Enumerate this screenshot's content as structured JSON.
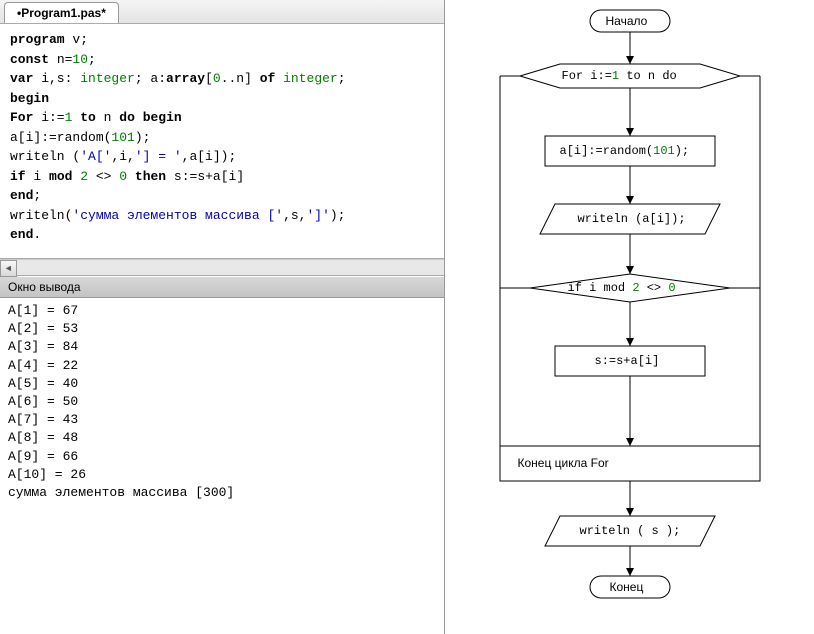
{
  "tab": {
    "title": "•Program1.pas*"
  },
  "code": {
    "l1a": "program",
    "l1b": " v;",
    "l2a": "const",
    "l2b": " n=",
    "l2c": "10",
    "l2d": ";",
    "l3a": "var",
    "l3b": " i,s: ",
    "l3c": "integer",
    "l3d": "; a:",
    "l3e": "array",
    "l3f": "[",
    "l3g": "0",
    "l3h": "..n] ",
    "l3i": "of",
    "l3j": " ",
    "l3k": "integer",
    "l3l": ";",
    "l4a": "begin",
    "l5a": "For",
    "l5b": " i:=",
    "l5c": "1",
    "l5d": " ",
    "l5e": "to",
    "l5f": " n ",
    "l5g": "do",
    "l5h": " ",
    "l5i": "begin",
    "l6a": "a[i]:=random(",
    "l6b": "101",
    "l6c": ");",
    "l7a": "writeln (",
    "l7b": "'A['",
    "l7c": ",i,",
    "l7d": "'] = '",
    "l7e": ",a[i]);",
    "l8a": "if",
    "l8b": " i ",
    "l8c": "mod",
    "l8d": " ",
    "l8e": "2",
    "l8f": " <> ",
    "l8g": "0",
    "l8h": " ",
    "l8i": "then",
    "l8j": " s:=s+a[i]",
    "l9a": "end",
    "l9b": ";",
    "l10a": "writeln(",
    "l10b": "'сумма элементов массива ['",
    "l10c": ",s,",
    "l10d": "']'",
    "l10e": ");",
    "l11a": "end",
    "l11b": "."
  },
  "output": {
    "header": "Окно вывода",
    "rows": [
      "A[1] = 67",
      "A[2] = 53",
      "A[3] = 84",
      "A[4] = 22",
      "A[5] = 40",
      "A[6] = 50",
      "A[7] = 43",
      "A[8] = 48",
      "A[9] = 66",
      "A[10] = 26",
      "сумма элементов массива [300]"
    ]
  },
  "flow": {
    "start": "Начало",
    "for_a": "For i:=",
    "for_b": "1",
    "for_c": " to n do",
    "rnd_a": "a[i]:=random(",
    "rnd_b": "101",
    "rnd_c": ");",
    "wr1": "writeln (a[i]);",
    "if_a": "if i mod ",
    "if_b": "2",
    "if_c": " <> ",
    "if_d": "0",
    "assign": "s:=s+a[i]",
    "endfor": "Конец цикла For",
    "wr2": "writeln ( s );",
    "end": "Конец"
  }
}
